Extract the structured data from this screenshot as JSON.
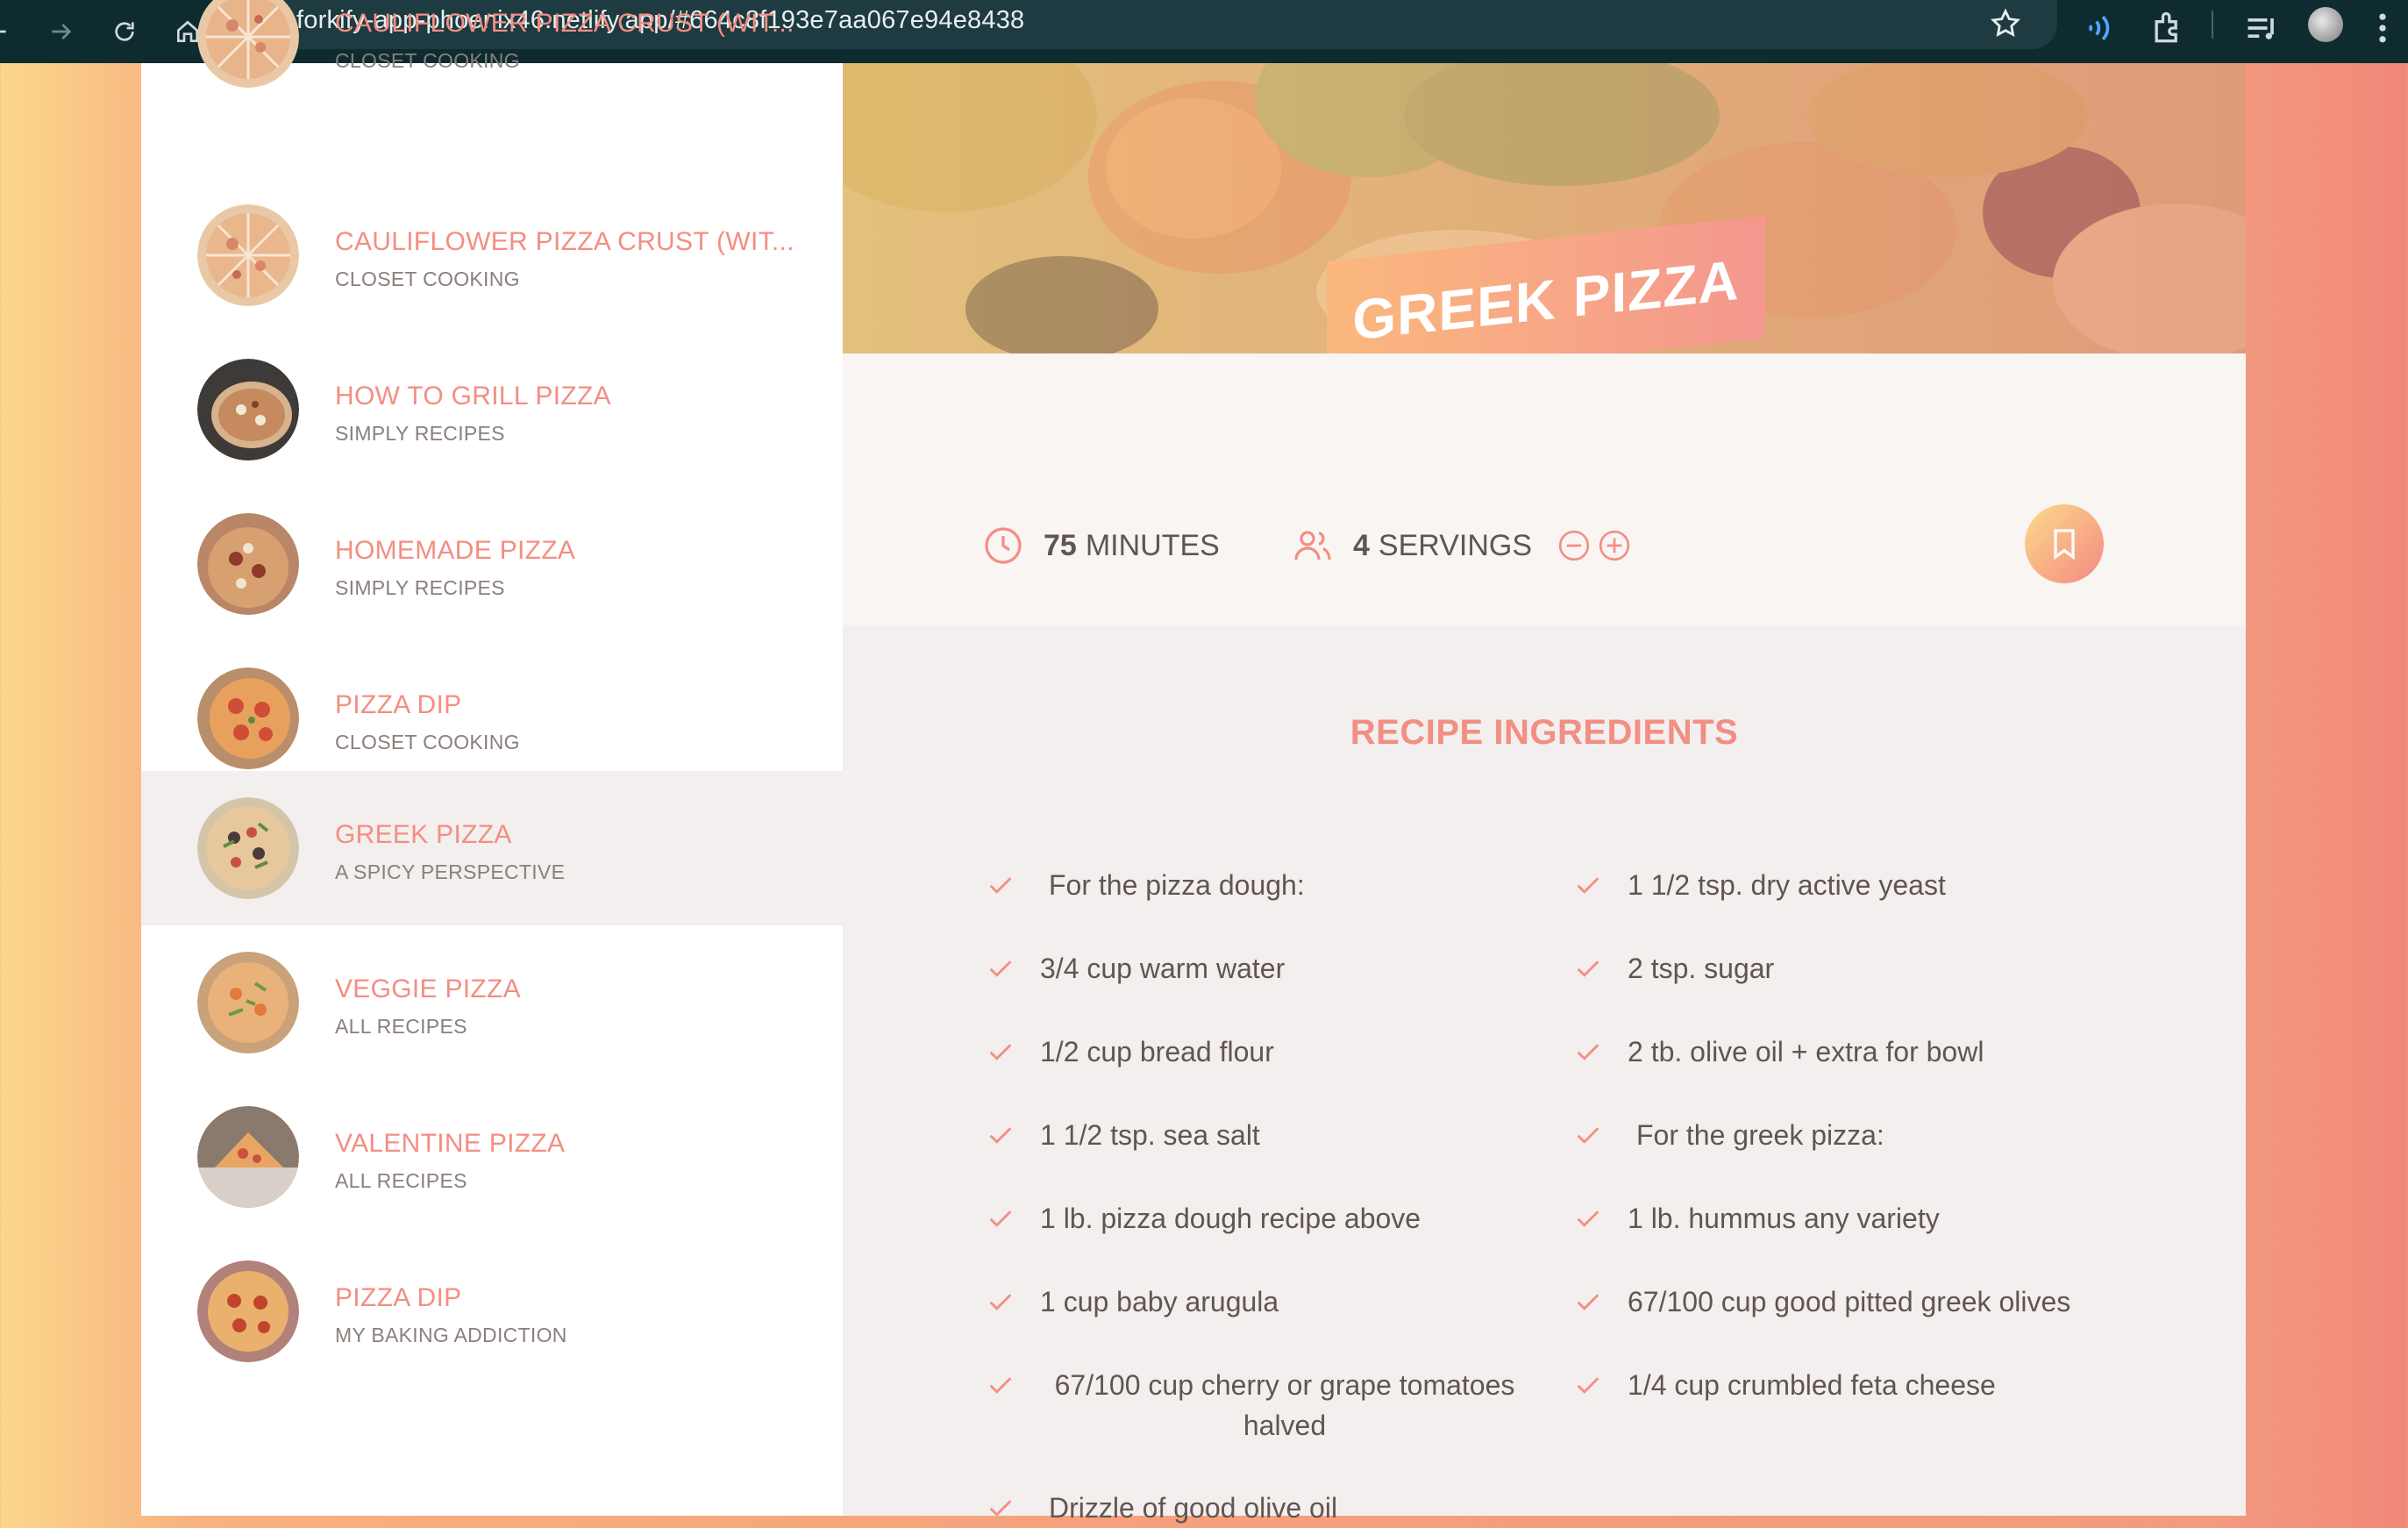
{
  "browser": {
    "url": "forkify-app-phoenix46.netlify.app/#664c8f193e7aa067e94e8438",
    "icons": [
      "back-arrow-icon",
      "forward-arrow-icon",
      "reload-icon",
      "home-icon",
      "site-settings-icon",
      "bookmark-star-icon",
      "read-aloud-icon",
      "extensions-icon",
      "media-queue-icon",
      "profile-avatar",
      "menu-dots-icon"
    ]
  },
  "results": [
    {
      "title": "Cauliflower Pizza Crust (wit...",
      "publisher": "Closet Cooking",
      "partial": true
    },
    {
      "title": "Cauliflower Pizza Crust (wit...",
      "publisher": "Closet Cooking"
    },
    {
      "title": "How to Grill Pizza",
      "publisher": "Simply Recipes"
    },
    {
      "title": "Homemade Pizza",
      "publisher": "Simply Recipes"
    },
    {
      "title": "Pizza Dip",
      "publisher": "Closet Cooking"
    },
    {
      "title": "Greek Pizza",
      "publisher": "A Spicy Perspective",
      "active": true
    },
    {
      "title": "Veggie Pizza",
      "publisher": "All Recipes"
    },
    {
      "title": "Valentine Pizza",
      "publisher": "All Recipes"
    },
    {
      "title": "Pizza Dip",
      "publisher": "My Baking Addiction"
    }
  ],
  "recipe": {
    "title": "Greek Pizza",
    "cooking_time": "75",
    "cooking_time_unit": "minutes",
    "servings": "4",
    "servings_unit": "servings",
    "ingredients_heading": "Recipe ingredients",
    "ingredients_left": [
      "For the pizza dough:",
      "3/4 cup warm water",
      "1/2 cup bread flour",
      "1 1/2 tsp. sea salt",
      "1 lb. pizza dough recipe above",
      "1 cup baby arugula",
      "67/100 cup cherry or grape tomatoes halved",
      "Drizzle of good olive oil"
    ],
    "ingredients_right": [
      "1 1/2 tsp. dry active yeast",
      "2 tsp. sugar",
      "2 tb. olive oil + extra for bowl",
      "For the greek pizza:",
      "1 lb. hummus any variety",
      "67/100 cup good pitted greek olives",
      "1/4 cup crumbled feta cheese"
    ]
  },
  "colors": {
    "accent": "#f38e82",
    "text": "#615551",
    "gradient_start": "#fbdb89",
    "gradient_end": "#f48982"
  }
}
